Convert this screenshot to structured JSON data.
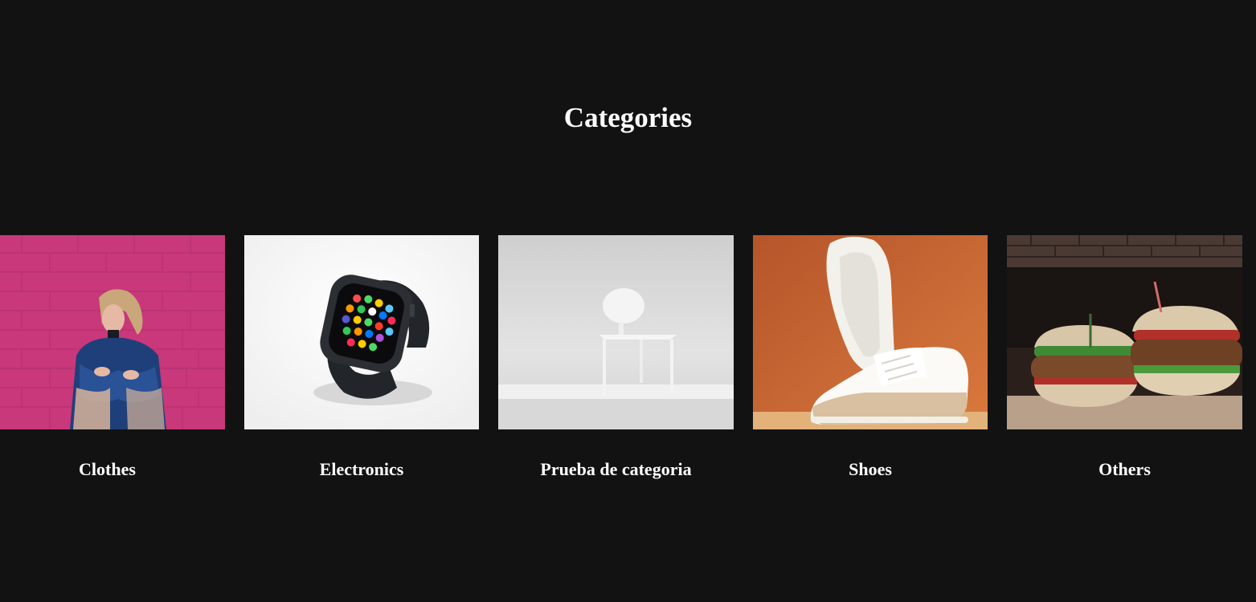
{
  "page": {
    "title": "Categories",
    "background": "#121212"
  },
  "categories": [
    {
      "label": "Clothes",
      "image": "woman-fashion-photo",
      "accent": "#c8387a"
    },
    {
      "label": "Electronics",
      "image": "smartwatch-photo",
      "accent": "#1c1e22"
    },
    {
      "label": "Prueba de categoria",
      "image": "white-chair-photo",
      "accent": "#d4d4d4"
    },
    {
      "label": "Shoes",
      "image": "sneakers-photo",
      "accent": "#cf6a2e"
    },
    {
      "label": "Others",
      "image": "burgers-photo",
      "accent": "#5a3a2a"
    }
  ]
}
